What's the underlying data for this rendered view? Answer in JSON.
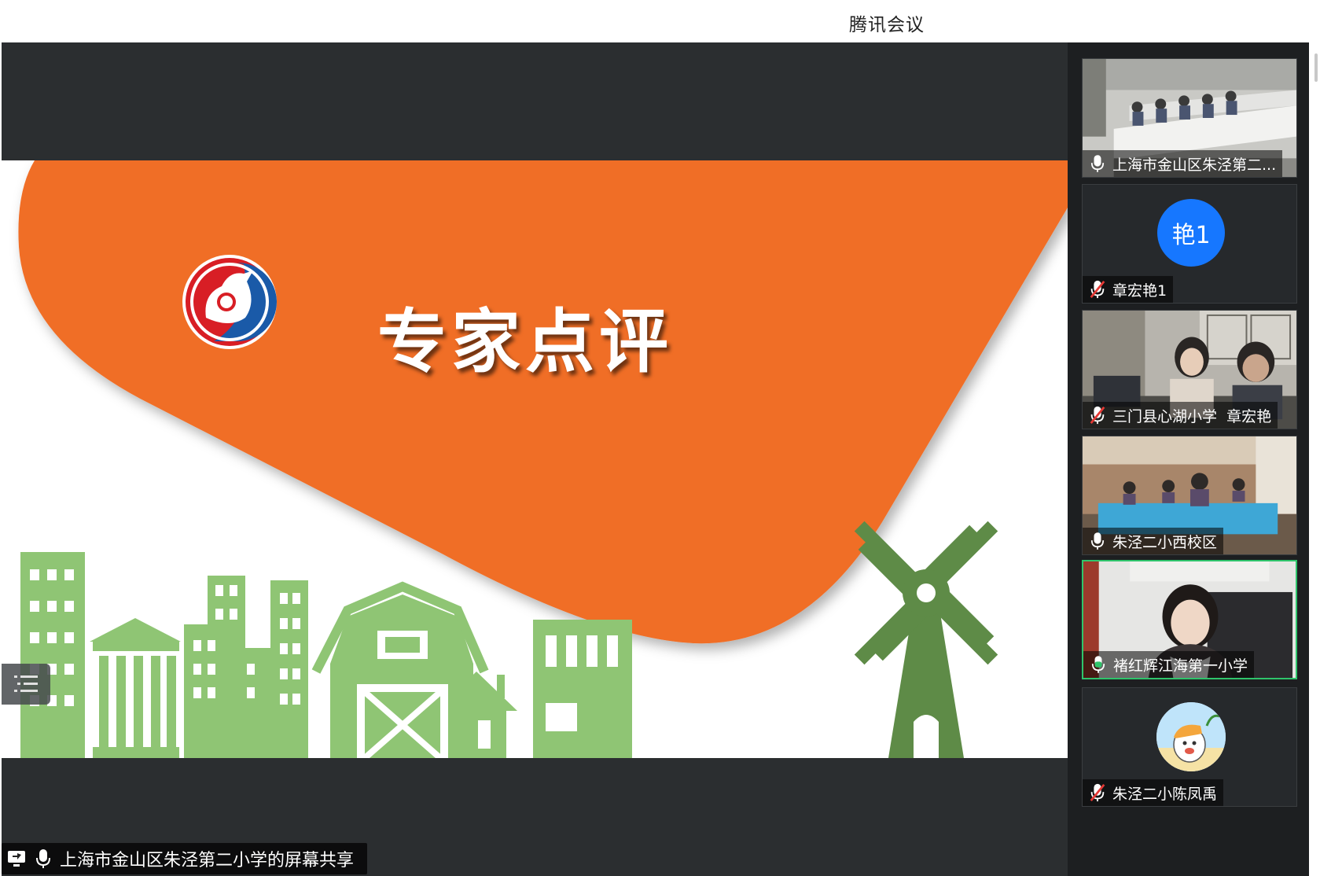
{
  "app": {
    "title": "腾讯会议"
  },
  "slide": {
    "title": "专家点评"
  },
  "share": {
    "label": "上海市金山区朱泾第二小学的屏幕共享"
  },
  "participants": [
    {
      "name": "上海市金山区朱泾第二...",
      "mic": "on",
      "type": "video"
    },
    {
      "name": "章宏艳1",
      "mic": "muted",
      "type": "avatar",
      "avatar_text": "艳1"
    },
    {
      "name": "三门县心湖小学  章宏艳",
      "mic": "muted",
      "type": "video"
    },
    {
      "name": "朱泾二小西校区",
      "mic": "on",
      "type": "video"
    },
    {
      "name": "褚红辉江海第一小学",
      "mic": "speaking",
      "type": "video",
      "active": true
    },
    {
      "name": "朱泾二小陈凤禹",
      "mic": "muted",
      "type": "avatar-image"
    }
  ],
  "colors": {
    "accent_orange": "#f06e28",
    "building_green": "#8fc574",
    "windmill_green": "#5e8b47",
    "avatar_blue": "#1677ff",
    "speaking_green": "#2fc46b"
  }
}
